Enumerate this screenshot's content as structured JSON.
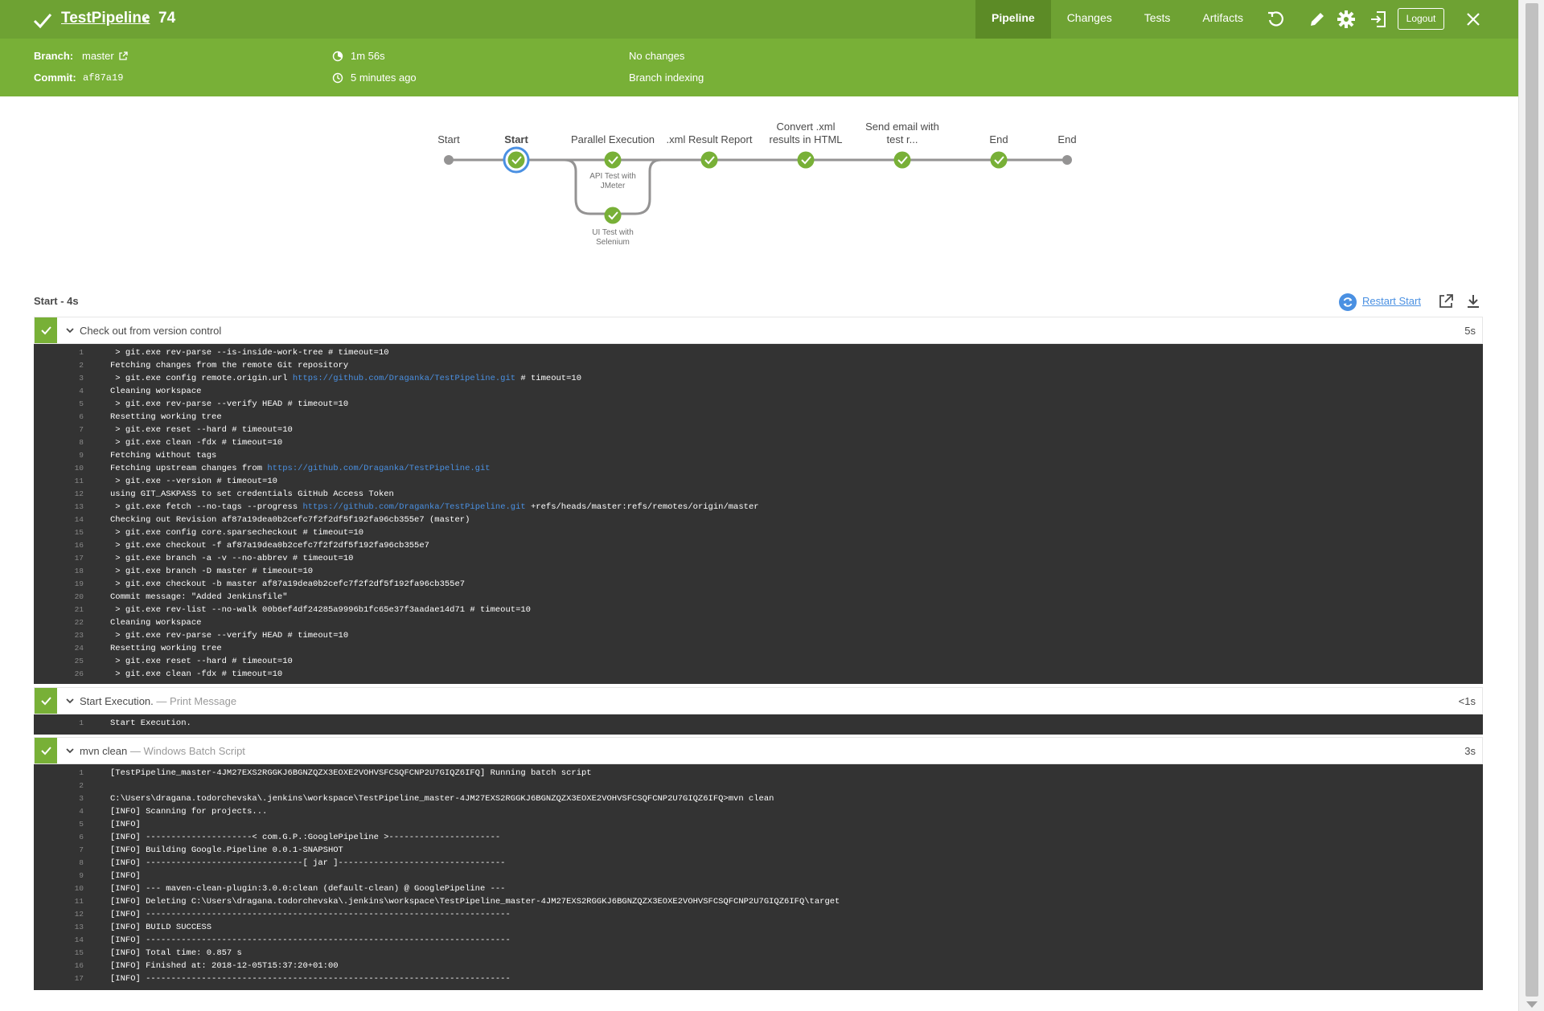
{
  "header": {
    "pipeline_name": "TestPipeline",
    "run_separator": "‹",
    "run_number": "74",
    "tabs": [
      {
        "label": "Pipeline",
        "active": true
      },
      {
        "label": "Changes",
        "active": false
      },
      {
        "label": "Tests",
        "active": false
      },
      {
        "label": "Artifacts",
        "active": false
      }
    ],
    "icons": [
      "replay-icon",
      "edit-icon",
      "settings-icon",
      "exit-classic-icon",
      "close-icon"
    ],
    "logout_label": "Logout",
    "accent_color": "#6ea233"
  },
  "summary": {
    "branch_label": "Branch:",
    "branch_value": "master",
    "commit_label": "Commit:",
    "commit_value": "af87a19",
    "duration": "1m 56s",
    "started": "5 minutes ago",
    "changes": "No changes",
    "cause": "Branch indexing"
  },
  "graph": {
    "stages": [
      {
        "label": "Start",
        "state": "not-built"
      },
      {
        "label": "Start",
        "state": "success",
        "selected": true
      },
      {
        "label": "Parallel Execution",
        "state": "success"
      },
      {
        "label": ".xml Result Report",
        "state": "success"
      },
      {
        "label_line1": "Convert .xml",
        "label_line2": "results in HTML",
        "state": "success"
      },
      {
        "label_line1": "Send email with",
        "label_line2": "test r...",
        "state": "success"
      },
      {
        "label": "End",
        "state": "success"
      },
      {
        "label": "End",
        "state": "not-built"
      }
    ],
    "parallel_branches": [
      {
        "line1": "API Test with",
        "line2": "JMeter",
        "state": "success"
      },
      {
        "line1": "UI Test with",
        "line2": "Selenium",
        "state": "success"
      }
    ]
  },
  "detail": {
    "stage_title": "Start - 4s",
    "restart_label": "Restart Start",
    "steps": [
      {
        "name": "Check out from version control",
        "desc": "",
        "time": "5s",
        "lines": [
          {
            "n": "1",
            "t": " > git.exe rev-parse --is-inside-work-tree # timeout=10"
          },
          {
            "n": "2",
            "t": "Fetching changes from the remote Git repository"
          },
          {
            "n": "3",
            "pre": " > git.exe config remote.origin.url ",
            "link": "https://github.com/Draganka/TestPipeline.git",
            "post": " # timeout=10"
          },
          {
            "n": "4",
            "t": "Cleaning workspace"
          },
          {
            "n": "5",
            "t": " > git.exe rev-parse --verify HEAD # timeout=10"
          },
          {
            "n": "6",
            "t": "Resetting working tree"
          },
          {
            "n": "7",
            "t": " > git.exe reset --hard # timeout=10"
          },
          {
            "n": "8",
            "t": " > git.exe clean -fdx # timeout=10"
          },
          {
            "n": "9",
            "t": "Fetching without tags"
          },
          {
            "n": "10",
            "pre": "Fetching upstream changes from ",
            "link": "https://github.com/Draganka/TestPipeline.git",
            "post": ""
          },
          {
            "n": "11",
            "t": " > git.exe --version # timeout=10"
          },
          {
            "n": "12",
            "t": "using GIT_ASKPASS to set credentials GitHub Access Token"
          },
          {
            "n": "13",
            "pre": " > git.exe fetch --no-tags --progress ",
            "link": "https://github.com/Draganka/TestPipeline.git",
            "post": " +refs/heads/master:refs/remotes/origin/master"
          },
          {
            "n": "14",
            "t": "Checking out Revision af87a19dea0b2cefc7f2f2df5f192fa96cb355e7 (master)"
          },
          {
            "n": "15",
            "t": " > git.exe config core.sparsecheckout # timeout=10"
          },
          {
            "n": "16",
            "t": " > git.exe checkout -f af87a19dea0b2cefc7f2f2df5f192fa96cb355e7"
          },
          {
            "n": "17",
            "t": " > git.exe branch -a -v --no-abbrev # timeout=10"
          },
          {
            "n": "18",
            "t": " > git.exe branch -D master # timeout=10"
          },
          {
            "n": "19",
            "t": " > git.exe checkout -b master af87a19dea0b2cefc7f2f2df5f192fa96cb355e7"
          },
          {
            "n": "20",
            "t": "Commit message: \"Added Jenkinsfile\""
          },
          {
            "n": "21",
            "t": " > git.exe rev-list --no-walk 00b6ef4df24285a9996b1fc65e37f3aadae14d71 # timeout=10"
          },
          {
            "n": "22",
            "t": "Cleaning workspace"
          },
          {
            "n": "23",
            "t": " > git.exe rev-parse --verify HEAD # timeout=10"
          },
          {
            "n": "24",
            "t": "Resetting working tree"
          },
          {
            "n": "25",
            "t": " > git.exe reset --hard # timeout=10"
          },
          {
            "n": "26",
            "t": " > git.exe clean -fdx # timeout=10"
          }
        ]
      },
      {
        "name": "Start Execution.",
        "desc": "— Print Message",
        "time": "<1s",
        "lines": [
          {
            "n": "1",
            "t": "Start Execution."
          }
        ]
      },
      {
        "name": "mvn clean",
        "desc": "— Windows Batch Script",
        "time": "3s",
        "lines": [
          {
            "n": "1",
            "t": "[TestPipeline_master-4JM27EXS2RGGKJ6BGNZQZX3EOXE2VOHVSFCSQFCNP2U7GIQZ6IFQ] Running batch script"
          },
          {
            "n": "2",
            "t": ""
          },
          {
            "n": "3",
            "t": "C:\\Users\\dragana.todorchevska\\.jenkins\\workspace\\TestPipeline_master-4JM27EXS2RGGKJ6BGNZQZX3EOXE2VOHVSFCSQFCNP2U7GIQZ6IFQ>mvn clean"
          },
          {
            "n": "4",
            "t": "[INFO] Scanning for projects..."
          },
          {
            "n": "5",
            "t": "[INFO]"
          },
          {
            "n": "6",
            "t": "[INFO] ---------------------< com.G.P.:GooglePipeline >----------------------"
          },
          {
            "n": "7",
            "t": "[INFO] Building Google.Pipeline 0.0.1-SNAPSHOT"
          },
          {
            "n": "8",
            "t": "[INFO] -------------------------------[ jar ]---------------------------------"
          },
          {
            "n": "9",
            "t": "[INFO]"
          },
          {
            "n": "10",
            "t": "[INFO] --- maven-clean-plugin:3.0.0:clean (default-clean) @ GooglePipeline ---"
          },
          {
            "n": "11",
            "t": "[INFO] Deleting C:\\Users\\dragana.todorchevska\\.jenkins\\workspace\\TestPipeline_master-4JM27EXS2RGGKJ6BGNZQZX3EOXE2VOHVSFCSQFCNP2U7GIQZ6IFQ\\target"
          },
          {
            "n": "12",
            "t": "[INFO] ------------------------------------------------------------------------"
          },
          {
            "n": "13",
            "t": "[INFO] BUILD SUCCESS"
          },
          {
            "n": "14",
            "t": "[INFO] ------------------------------------------------------------------------"
          },
          {
            "n": "15",
            "t": "[INFO] Total time: 0.857 s"
          },
          {
            "n": "16",
            "t": "[INFO] Finished at: 2018-12-05T15:37:20+01:00"
          },
          {
            "n": "17",
            "t": "[INFO] ------------------------------------------------------------------------"
          }
        ]
      }
    ]
  }
}
